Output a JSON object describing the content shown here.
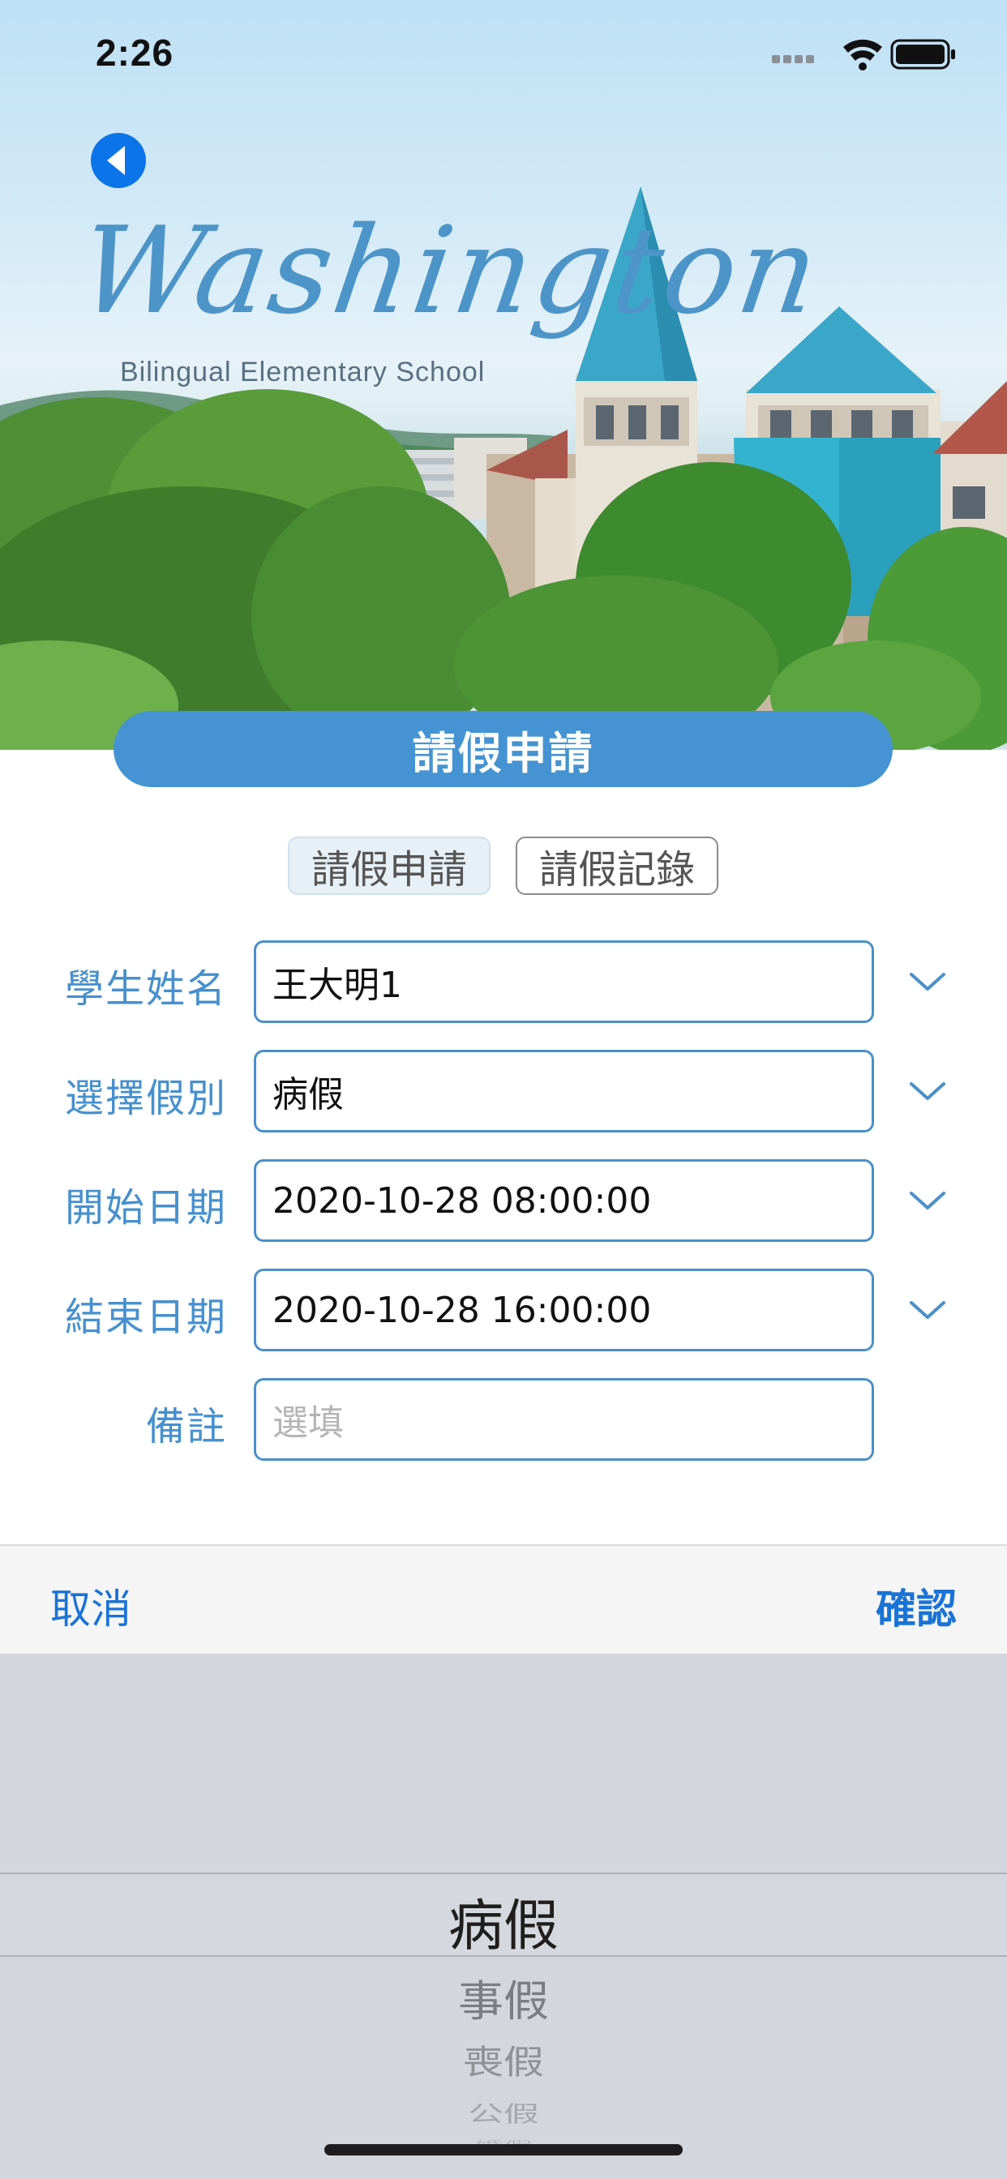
{
  "status_bar": {
    "time": "2:26"
  },
  "hero": {
    "logo_script": "Washington",
    "logo_subtitle": "Bilingual Elementary School"
  },
  "page": {
    "title": "請假申請"
  },
  "tabs": [
    {
      "label": "請假申請",
      "selected": true
    },
    {
      "label": "請假記錄",
      "selected": false
    }
  ],
  "form": {
    "student_name": {
      "label": "學生姓名",
      "value": "王大明1"
    },
    "leave_type": {
      "label": "選擇假別",
      "value": "病假"
    },
    "start_date": {
      "label": "開始日期",
      "value": "2020-10-28 08:00:00"
    },
    "end_date": {
      "label": "結束日期",
      "value": "2020-10-28 16:00:00"
    },
    "note": {
      "label": "備註",
      "placeholder": "選填",
      "value": ""
    }
  },
  "picker_toolbar": {
    "cancel": "取消",
    "confirm": "確認"
  },
  "picker": {
    "selected": "病假",
    "options": [
      "病假",
      "事假",
      "喪假",
      "公假",
      "婚假"
    ]
  },
  "colors": {
    "accent": "#4593d2",
    "label_blue": "#4690cf",
    "toolbar_blue": "#1a73d6",
    "picker_bg": "#d3d6dc"
  }
}
